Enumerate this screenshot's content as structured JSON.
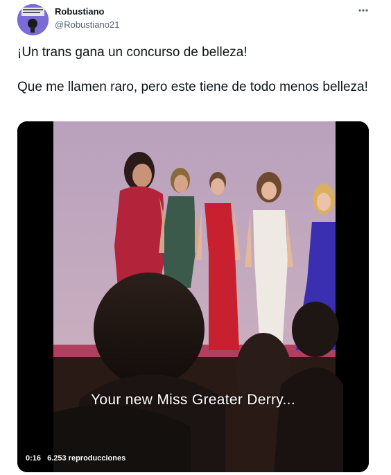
{
  "author": {
    "name": "Robustiano",
    "handle": "@Robustiano21"
  },
  "tweet": {
    "text": "¡Un trans gana un concurso de belleza!\n\nQue me llamen raro, pero este tiene de todo menos belleza!"
  },
  "video": {
    "caption": "Your new Miss Greater Derry...",
    "time": "0:16",
    "views": "6.253 reproducciones"
  },
  "colors": {
    "text": "#0f1419",
    "secondary": "#536471",
    "stage": "#b29bb5"
  },
  "icons": {
    "more": "more-horizontal-icon",
    "avatar": "avatar-image"
  }
}
